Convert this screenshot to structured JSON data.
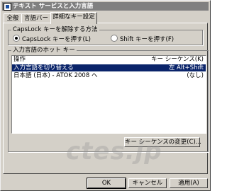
{
  "window": {
    "title": "テキスト サービスと入力言語"
  },
  "tabs": [
    {
      "label": "全般"
    },
    {
      "label": "言語バー"
    },
    {
      "label": "詳細なキー設定"
    }
  ],
  "capslock_group": {
    "label": "CapsLock キーを解除する方法",
    "options": [
      {
        "label": "CapsLock キーを押す(L)",
        "checked": true
      },
      {
        "label": "Shift キーを押す(F)",
        "checked": false
      }
    ]
  },
  "hotkey_group": {
    "label": "入力言語のホット キー",
    "columns": {
      "operation": "操作",
      "key_sequence": "キー シーケンス(K)"
    },
    "rows": [
      {
        "operation": "入力言語を切り替える",
        "key_sequence": "左 Alt+Shift",
        "selected": true
      },
      {
        "operation": "日本語 (日本) - ATOK 2008 へ",
        "key_sequence": "(なし)",
        "selected": false
      }
    ],
    "change_button": "キー シーケンスの変更(C)..."
  },
  "footer_buttons": {
    "ok": "OK",
    "cancel": "キャンセル",
    "apply": "適用(A)"
  },
  "watermark": "ctes.jp",
  "colors": {
    "selection": "#0a246a",
    "face": "#d4d0c8",
    "titlebar": "#808080"
  }
}
